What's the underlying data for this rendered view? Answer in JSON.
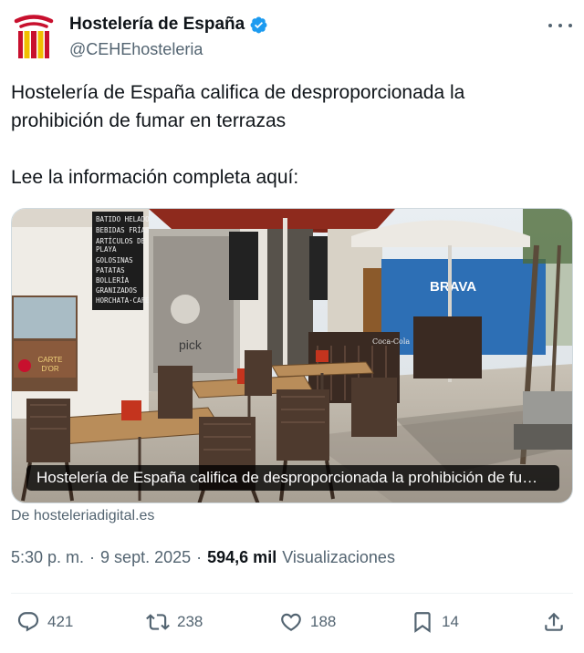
{
  "account": {
    "name": "Hostelería de España",
    "handle": "@CEHEhosteleria",
    "verified": true
  },
  "tweet": {
    "text_line1": "Hostelería de España califica de desproporcionada la",
    "text_line2": "prohibición de fumar en terrazas",
    "text_line3": "Lee la información completa aquí:"
  },
  "card": {
    "title": "Hostelería de España califica de desproporcionada la prohibición de fumar en terrazas",
    "source": "De hosteleriadigital.es",
    "image_signs": {
      "menu_board": [
        "BATIDO HELADO",
        "BEBIDAS FRÍAS",
        "ARTÍCULOS DE PLAYA",
        "GOLOSINAS",
        "PATATAS",
        "BOLLERÍA",
        "GRANIZADOS",
        "HORCHATA",
        "CAFÉ"
      ],
      "ice_cream_brand": "CARTE D'OR",
      "cola_brand": "Coca-Cola",
      "blue_wall_text": "BRAVA",
      "window_text": "pick"
    }
  },
  "meta": {
    "time": "5:30 p. m.",
    "separator": "·",
    "date": "9 sept. 2025",
    "views_count": "594,6 mil",
    "views_label": "Visualizaciones"
  },
  "actions": {
    "replies": "421",
    "retweets": "238",
    "likes": "188",
    "bookmarks": "14"
  },
  "colors": {
    "text_primary": "#0f1419",
    "text_secondary": "#536471",
    "verified_blue": "#1d9bf0",
    "divider": "#eff3f4",
    "logo_red": "#c8102e",
    "logo_yellow": "#f1bf00"
  },
  "icons": {
    "more": "more-icon",
    "verified": "verified-badge-icon",
    "reply": "reply-icon",
    "retweet": "retweet-icon",
    "like": "heart-icon",
    "bookmark": "bookmark-icon",
    "share": "share-icon"
  }
}
